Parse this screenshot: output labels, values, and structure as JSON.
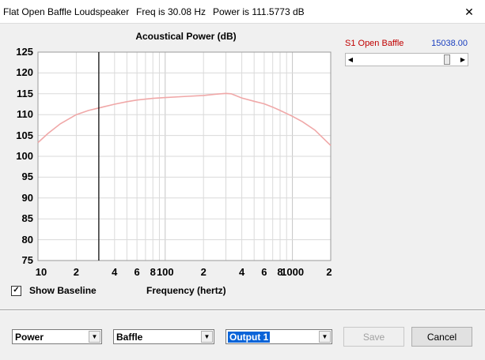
{
  "window": {
    "title": "Flat Open Baffle Loudspeaker",
    "freq_readout": "Freq is 30.08 Hz",
    "power_readout": "Power is 111.5773 dB"
  },
  "chart_data": {
    "type": "line",
    "title": "Acoustical Power (dB)",
    "xlabel": "Frequency (hertz)",
    "ylabel": "",
    "x_scale": "log",
    "xlim": [
      10,
      2000
    ],
    "ylim": [
      75,
      125
    ],
    "y_ticks": [
      75,
      80,
      85,
      90,
      95,
      100,
      105,
      110,
      115,
      120,
      125
    ],
    "x_tick_labels": [
      {
        "value": 10,
        "label": "10"
      },
      {
        "value": 20,
        "label": "2"
      },
      {
        "value": 40,
        "label": "4"
      },
      {
        "value": 60,
        "label": "6"
      },
      {
        "value": 80,
        "label": "8"
      },
      {
        "value": 100,
        "label": "100"
      },
      {
        "value": 200,
        "label": "2"
      },
      {
        "value": 400,
        "label": "4"
      },
      {
        "value": 600,
        "label": "6"
      },
      {
        "value": 800,
        "label": "8"
      },
      {
        "value": 1000,
        "label": "1000"
      },
      {
        "value": 2000,
        "label": "2"
      }
    ],
    "grid": true,
    "cursor_x": 30.08,
    "series": [
      {
        "color": "#f0a8a8",
        "x": [
          10,
          12,
          15,
          20,
          25,
          30,
          40,
          50,
          60,
          80,
          100,
          150,
          200,
          250,
          300,
          330,
          400,
          500,
          600,
          700,
          800,
          1000,
          1200,
          1500,
          2000
        ],
        "y": [
          103.3,
          105.5,
          107.8,
          110.0,
          111.0,
          111.6,
          112.5,
          113.1,
          113.5,
          113.9,
          114.1,
          114.4,
          114.6,
          114.9,
          115.1,
          115.0,
          114.0,
          113.2,
          112.6,
          111.8,
          111.0,
          109.6,
          108.3,
          106.3,
          102.6
        ]
      }
    ]
  },
  "baseline": {
    "label": "Show Baseline",
    "checked": true,
    "check_glyph": "✓"
  },
  "slider": {
    "label": "S1  Open Baffle",
    "value": "15038.00",
    "position_fraction": 0.92,
    "left_arrow": "◀",
    "right_arrow": "▶"
  },
  "controls": {
    "combo_power": "Power",
    "combo_baffle": "Baffle",
    "combo_output": "Output 1",
    "dropdown_glyph": "▼",
    "save_label": "Save",
    "cancel_label": "Cancel",
    "close_glyph": "✕"
  }
}
